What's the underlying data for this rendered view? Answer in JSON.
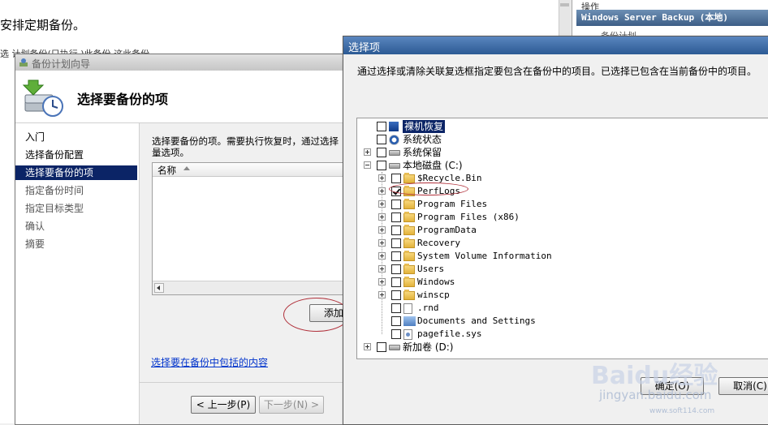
{
  "background": {
    "heading": "安排定期备份。",
    "strip_text": "选 计划备份(只执行 )此备份  这此备份"
  },
  "actions_pane": {
    "title": "操作",
    "bar_title": "Windows Server Backup (本地)",
    "item": "备份计划"
  },
  "wizard": {
    "title": "备份计划向导",
    "header_title": "选择要备份的项",
    "nav": [
      "入门",
      "选择备份配置",
      "选择要备份的项",
      "指定备份时间",
      "指定目标类型",
      "确认",
      "摘要"
    ],
    "active_nav_index": 2,
    "description_line1": "选择要备份的项。需要执行恢复时，通过选择",
    "description_line2": "量选项。",
    "list_column_name": "名称",
    "add_items_label": "添加项",
    "include_link": "选择要在备份中包括的内容",
    "prev_label": "< 上一步(P)",
    "next_label": "下一步(N) >"
  },
  "dialog": {
    "title": "选择项",
    "instruction": "通过选择或清除关联复选框指定要包含在备份中的项目。已选择已包含在当前备份中的项目。",
    "tree": [
      {
        "label": "裸机恢复",
        "level": 0,
        "expander": "none",
        "checked": false,
        "icon": "bare-metal-icon",
        "selected": true
      },
      {
        "label": "系统状态",
        "level": 0,
        "expander": "none",
        "checked": false,
        "icon": "system-state-icon",
        "selected": false
      },
      {
        "label": "系统保留",
        "level": 0,
        "expander": "plus",
        "checked": false,
        "icon": "drive-icon",
        "selected": false
      },
      {
        "label": "本地磁盘 (C:)",
        "level": 0,
        "expander": "minus",
        "checked": false,
        "icon": "drive-icon",
        "selected": false
      },
      {
        "label": "$Recycle.Bin",
        "level": 1,
        "expander": "plus",
        "checked": false,
        "icon": "folder-icon",
        "selected": false
      },
      {
        "label": "PerfLogs",
        "level": 1,
        "expander": "plus",
        "checked": true,
        "icon": "folder-icon",
        "selected": false
      },
      {
        "label": "Program Files",
        "level": 1,
        "expander": "plus",
        "checked": false,
        "icon": "folder-icon",
        "selected": false
      },
      {
        "label": "Program Files (x86)",
        "level": 1,
        "expander": "plus",
        "checked": false,
        "icon": "folder-icon",
        "selected": false
      },
      {
        "label": "ProgramData",
        "level": 1,
        "expander": "plus",
        "checked": false,
        "icon": "folder-icon",
        "selected": false
      },
      {
        "label": "Recovery",
        "level": 1,
        "expander": "plus",
        "checked": false,
        "icon": "folder-icon",
        "selected": false
      },
      {
        "label": "System Volume Information",
        "level": 1,
        "expander": "plus",
        "checked": false,
        "icon": "folder-icon",
        "selected": false
      },
      {
        "label": "Users",
        "level": 1,
        "expander": "plus",
        "checked": false,
        "icon": "folder-icon",
        "selected": false
      },
      {
        "label": "Windows",
        "level": 1,
        "expander": "plus",
        "checked": false,
        "icon": "folder-icon",
        "selected": false
      },
      {
        "label": "winscp",
        "level": 1,
        "expander": "plus",
        "checked": false,
        "icon": "folder-icon",
        "selected": false
      },
      {
        "label": ".rnd",
        "level": 1,
        "expander": "none",
        "checked": false,
        "icon": "file-icon",
        "selected": false
      },
      {
        "label": "Documents and Settings",
        "level": 1,
        "expander": "none",
        "checked": false,
        "icon": "shortcut-folder-icon",
        "selected": false
      },
      {
        "label": "pagefile.sys",
        "level": 1,
        "expander": "none",
        "checked": false,
        "icon": "system-file-icon",
        "selected": false
      },
      {
        "label": "新加卷 (D:)",
        "level": 0,
        "expander": "plus",
        "checked": false,
        "icon": "drive-icon",
        "selected": false
      }
    ],
    "ok_label": "确定(O)",
    "cancel_label": "取消(C)"
  },
  "watermark": {
    "brand": "Baidu经验",
    "sub": "jingyan.baidu.com",
    "site": "www.soft114.com"
  }
}
